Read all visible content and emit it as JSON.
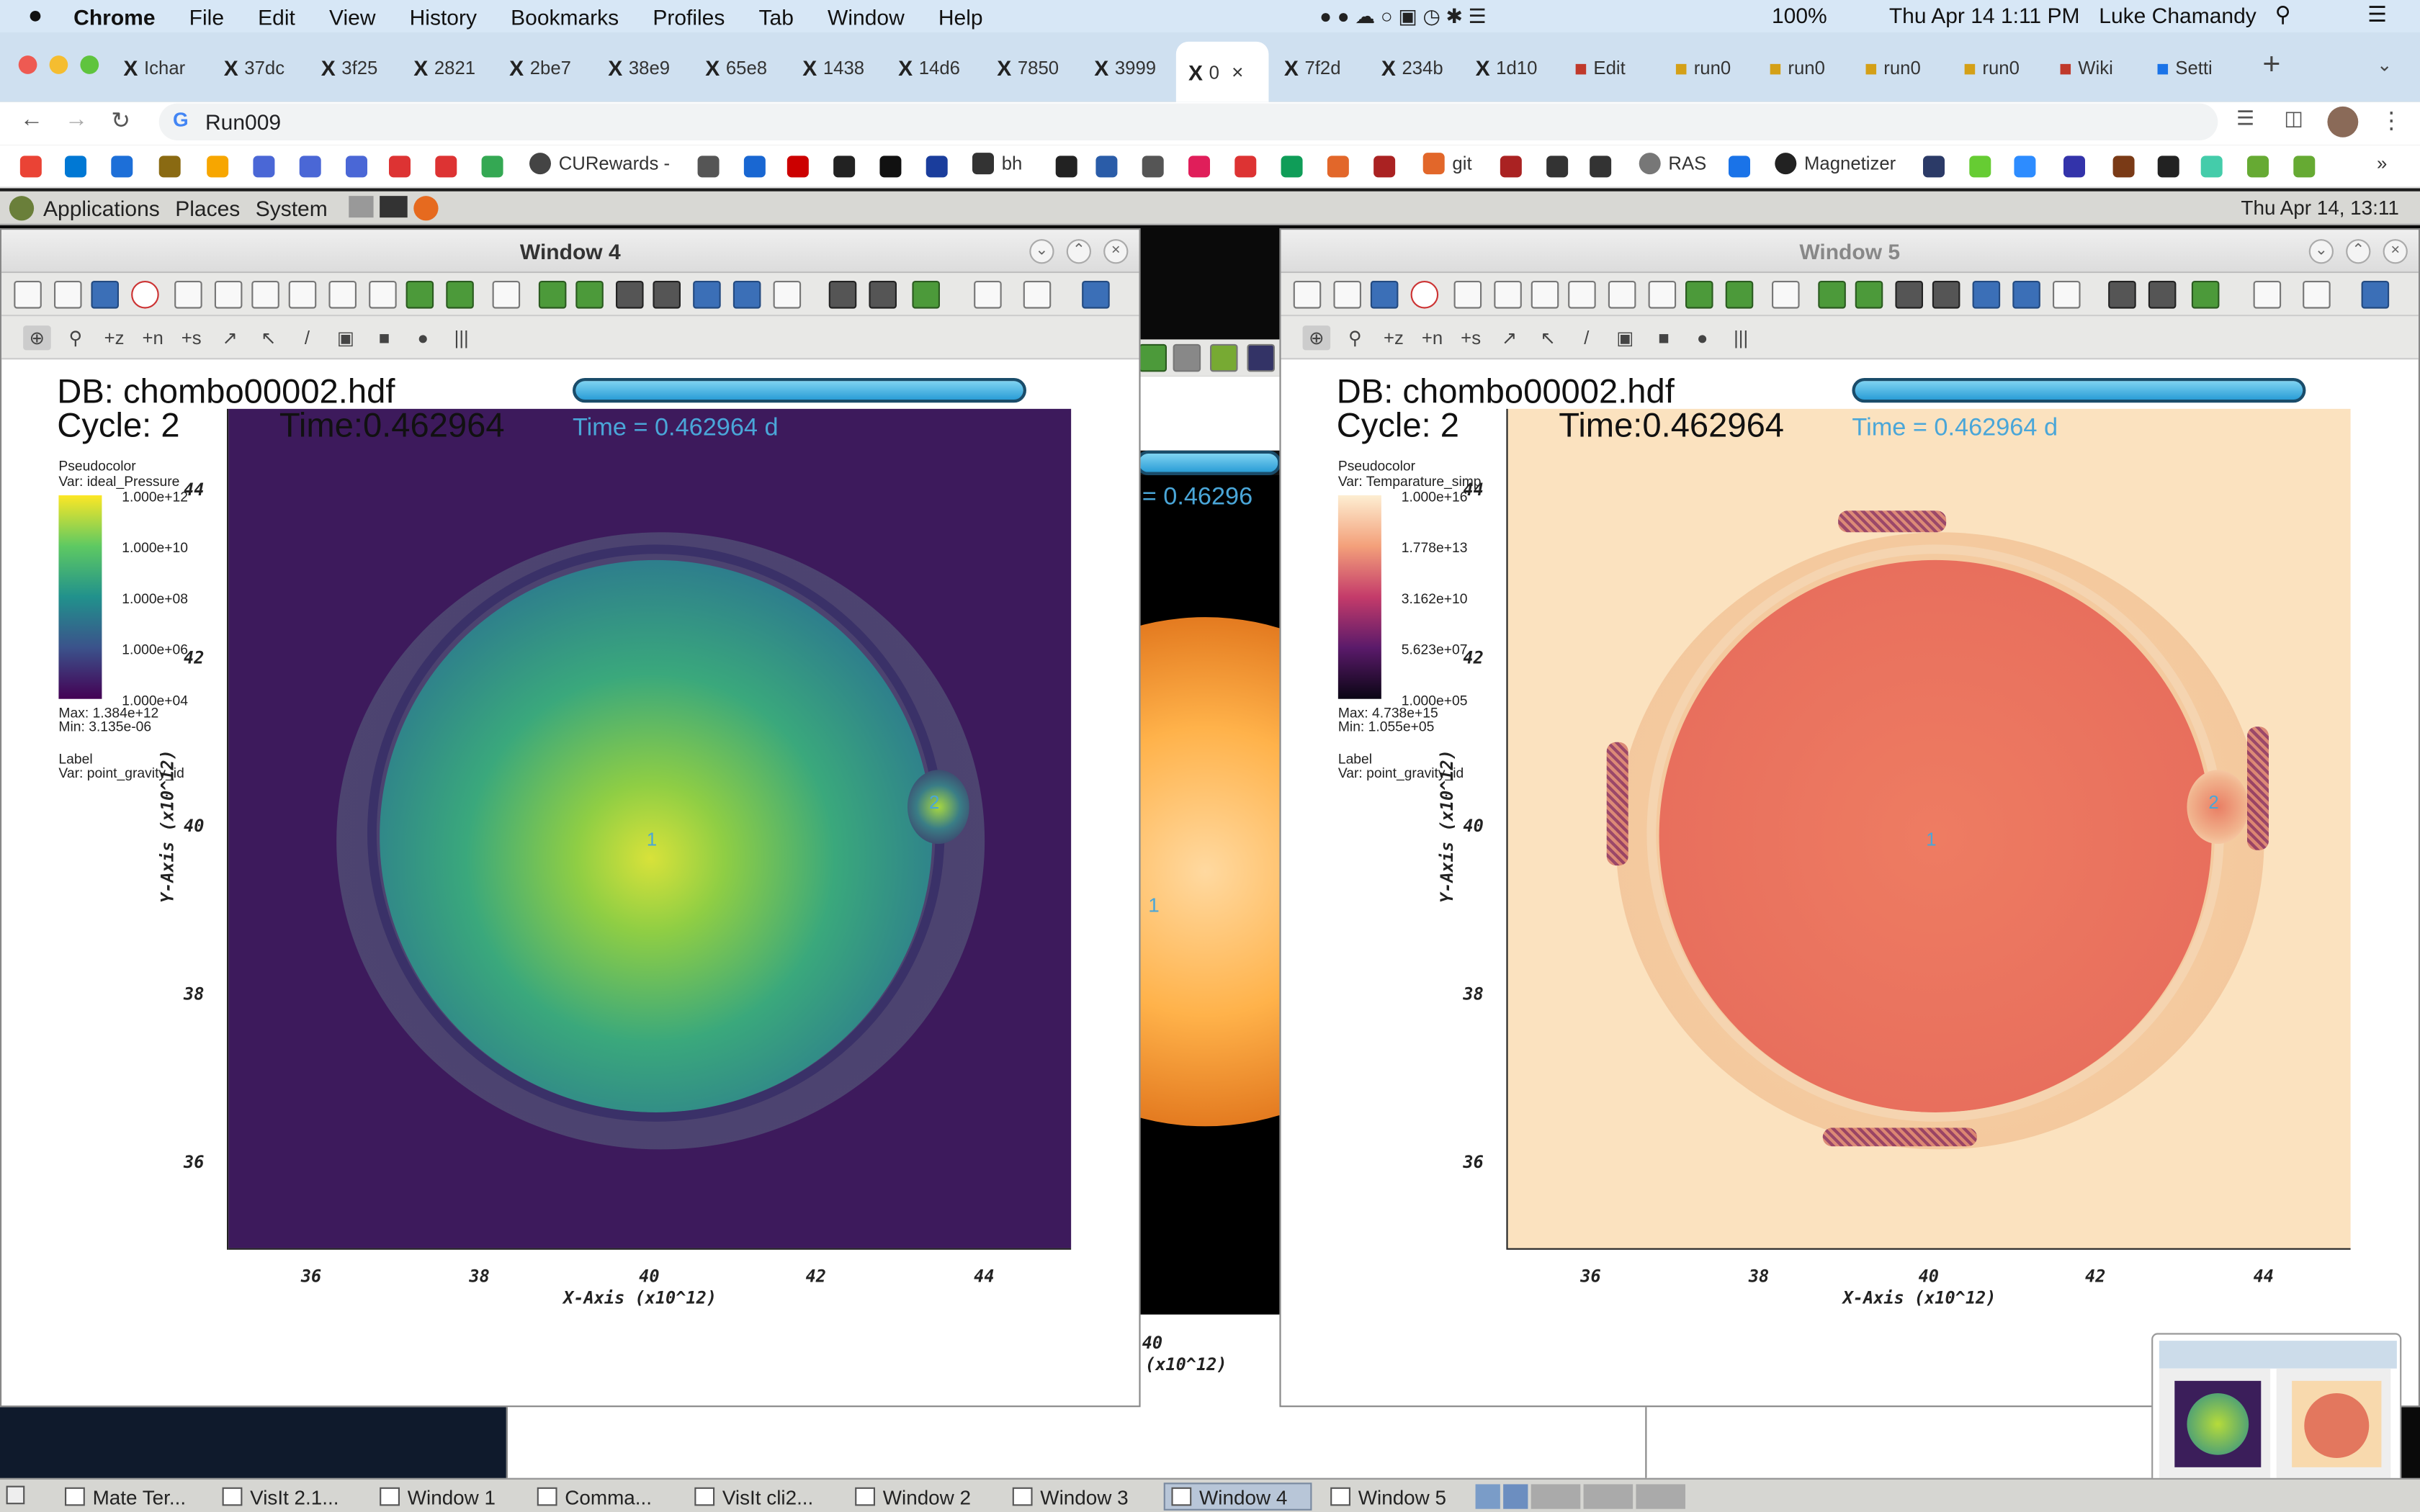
{
  "macbar": {
    "app": "Chrome",
    "menus": [
      "File",
      "Edit",
      "View",
      "History",
      "Bookmarks",
      "Profiles",
      "Tab",
      "Window",
      "Help"
    ],
    "battery": "100%",
    "datetime": "Thu Apr 14  1:11 PM",
    "user": "Luke Chamandy"
  },
  "tabs": [
    "Ichar",
    "37dc",
    "3f25",
    "2821",
    "2be7",
    "38e9",
    "65e8",
    "1438",
    "14d6",
    "7850",
    "3999",
    "0",
    "7f2d",
    "234b",
    "1d10",
    "Edit",
    "run0",
    "run0",
    "run0",
    "run0",
    "Wiki",
    "Setti"
  ],
  "address": "Run009",
  "bookmarks": [
    "CURewards -",
    "bh",
    "git",
    "RAS",
    "Magnetizer"
  ],
  "gnome": {
    "menus": [
      "Applications",
      "Places",
      "System"
    ],
    "datetime": "Thu Apr 14, 13:11"
  },
  "win4": {
    "title": "Window 4",
    "db": "DB: chombo00002.hdf",
    "cycle": "Cycle: 2",
    "time_black": "Time:0.462964",
    "time_blue": "Time = 0.462964 d",
    "legend_type": "Pseudocolor",
    "legend_var": "Var: ideal_Pressure",
    "legend_ticks": [
      "1.000e+12",
      "1.000e+10",
      "1.000e+08",
      "1.000e+06",
      "1.000e+04"
    ],
    "max": "Max:  1.384e+12",
    "min": "Min:  3.135e-06",
    "label_type": "Label",
    "label_var": "Var: point_gravity_id",
    "point1": "1",
    "point2": "2",
    "xlabel": "X-Axis (x10^12)",
    "ylabel": "Y-Axis (x10^12)",
    "xticks": [
      "36",
      "38",
      "40",
      "42",
      "44"
    ],
    "yticks": [
      "44",
      "42",
      "40",
      "38",
      "36"
    ]
  },
  "win5": {
    "title": "Window 5",
    "db": "DB: chombo00002.hdf",
    "cycle": "Cycle: 2",
    "time_black": "Time:0.462964",
    "time_blue": "Time = 0.462964 d",
    "legend_type": "Pseudocolor",
    "legend_var": "Var: Temparature_simp",
    "legend_ticks": [
      "1.000e+16",
      "1.778e+13",
      "3.162e+10",
      "5.623e+07",
      "1.000e+05"
    ],
    "max": "Max:  4.738e+15",
    "min": "Min:  1.055e+05",
    "label_type": "Label",
    "label_var": "Var: point_gravity_id",
    "point1": "1",
    "point2": "2",
    "xlabel": "X-Axis (x10^12)",
    "ylabel": "Y-Axis (x10^12)",
    "xticks": [
      "36",
      "38",
      "40",
      "42",
      "44"
    ],
    "yticks": [
      "44",
      "42",
      "40",
      "38",
      "36"
    ]
  },
  "behind": {
    "time_blue": "= 0.46296",
    "point": "1",
    "xtick": "40",
    "xunit": "(x10^12)"
  },
  "taskbar": [
    "Mate Ter...",
    "VisIt 2.1...",
    "Window 1",
    "Comma...",
    "VisIt cli2...",
    "Window 2",
    "Window 3",
    "Window 4",
    "Window 5"
  ]
}
